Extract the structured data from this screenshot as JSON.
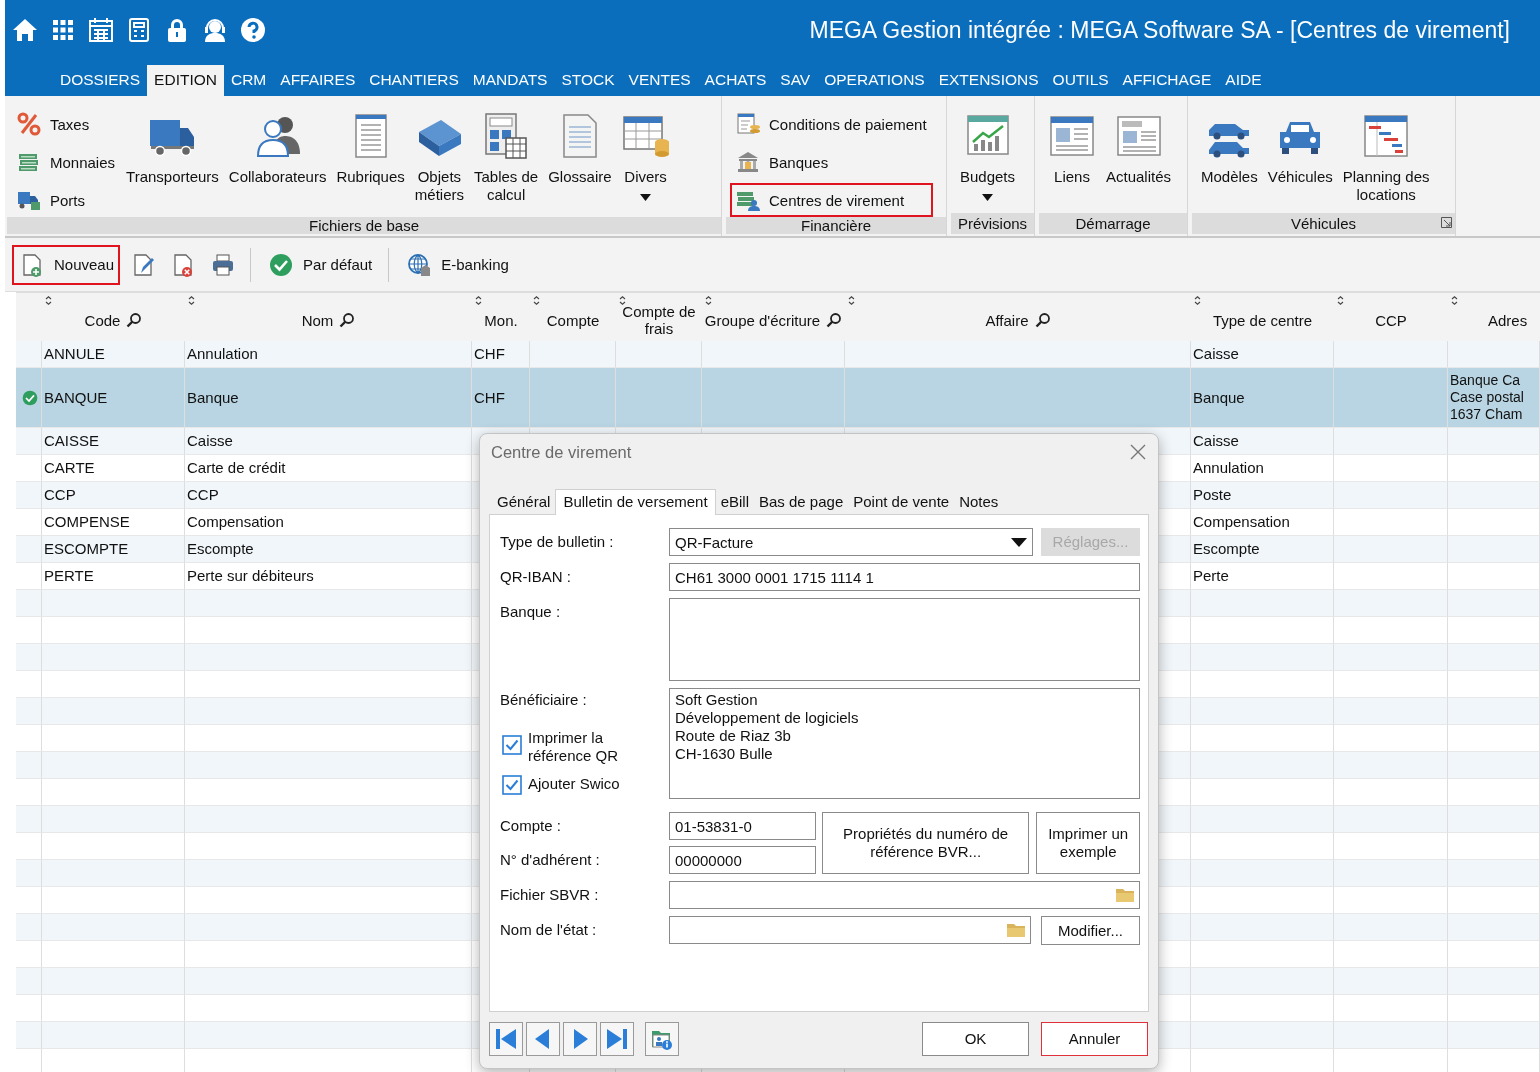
{
  "window": {
    "title": "MEGA Gestion intégrée : MEGA Software SA - [Centres de virement]"
  },
  "menu": [
    {
      "label": "DOSSIERS",
      "selected": false
    },
    {
      "label": "EDITION",
      "selected": true
    },
    {
      "label": "CRM",
      "selected": false
    },
    {
      "label": "AFFAIRES",
      "selected": false
    },
    {
      "label": "CHANTIERS",
      "selected": false
    },
    {
      "label": "MANDATS",
      "selected": false
    },
    {
      "label": "STOCK",
      "selected": false
    },
    {
      "label": "VENTES",
      "selected": false
    },
    {
      "label": "ACHATS",
      "selected": false
    },
    {
      "label": "SAV",
      "selected": false
    },
    {
      "label": "OPERATIONS",
      "selected": false
    },
    {
      "label": "EXTENSIONS",
      "selected": false
    },
    {
      "label": "OUTILS",
      "selected": false
    },
    {
      "label": "AFFICHAGE",
      "selected": false
    },
    {
      "label": "AIDE",
      "selected": false
    }
  ],
  "ribbon": {
    "groups": [
      {
        "label": "Fichiers de base",
        "items": [
          {
            "kind": "small",
            "label": "Taxes",
            "highlighted": false,
            "dropdown": false
          },
          {
            "kind": "small",
            "label": "Monnaies",
            "highlighted": false,
            "dropdown": false
          },
          {
            "kind": "small",
            "label": "Ports",
            "highlighted": false,
            "dropdown": false
          },
          {
            "kind": "large",
            "label": "Transporteurs",
            "highlighted": false,
            "dropdown": false
          },
          {
            "kind": "large",
            "label": "Collaborateurs",
            "highlighted": false,
            "dropdown": false
          },
          {
            "kind": "large",
            "label": "Rubriques",
            "highlighted": false,
            "dropdown": false
          },
          {
            "kind": "large",
            "label": "Objets\nmétiers",
            "highlighted": false,
            "dropdown": false
          },
          {
            "kind": "large",
            "label": "Tables de\ncalcul",
            "highlighted": false,
            "dropdown": false
          },
          {
            "kind": "large",
            "label": "Glossaire",
            "highlighted": false,
            "dropdown": false
          },
          {
            "kind": "large",
            "label": "Divers",
            "highlighted": false,
            "dropdown": true
          }
        ]
      },
      {
        "label": "Financière",
        "items": [
          {
            "kind": "small",
            "label": "Conditions de paiement",
            "highlighted": false,
            "dropdown": false
          },
          {
            "kind": "small",
            "label": "Banques",
            "highlighted": false,
            "dropdown": false
          },
          {
            "kind": "small",
            "label": "Centres de virement",
            "highlighted": true,
            "dropdown": false
          }
        ]
      },
      {
        "label": "Prévisions",
        "items": [
          {
            "kind": "large",
            "label": "Budgets",
            "highlighted": false,
            "dropdown": true
          }
        ]
      },
      {
        "label": "Démarrage",
        "items": [
          {
            "kind": "large",
            "label": "Liens",
            "highlighted": false,
            "dropdown": false
          },
          {
            "kind": "large",
            "label": "Actualités",
            "highlighted": false,
            "dropdown": false
          }
        ]
      },
      {
        "label": "Véhicules",
        "launcher": true,
        "items": [
          {
            "kind": "large",
            "label": "Modèles",
            "highlighted": false,
            "dropdown": false
          },
          {
            "kind": "large",
            "label": "Véhicules",
            "highlighted": false,
            "dropdown": false
          },
          {
            "kind": "large",
            "label": "Planning des\nlocations",
            "highlighted": false,
            "dropdown": false
          }
        ]
      }
    ]
  },
  "toolbar": {
    "buttons": [
      {
        "label": "Nouveau",
        "highlighted": true
      },
      {
        "label": "Par défaut",
        "highlighted": false
      },
      {
        "label": "E-banking",
        "highlighted": false
      }
    ]
  },
  "grid": {
    "columns": [
      {
        "label": "Code",
        "filter": true
      },
      {
        "label": "Nom",
        "filter": true
      },
      {
        "label": "Mon."
      },
      {
        "label": "Compte"
      },
      {
        "label": "Compte de frais"
      },
      {
        "label": "Groupe d'écriture",
        "filter": true
      },
      {
        "label": "Affaire",
        "filter": true
      },
      {
        "label": "Type de centre"
      },
      {
        "label": "CCP"
      },
      {
        "label": "Adres"
      }
    ],
    "rows": [
      {
        "selected": false,
        "default": false,
        "code": "ANNULE",
        "nom": "Annulation",
        "mon": "CHF",
        "type_de_centre": "Caisse"
      },
      {
        "selected": true,
        "default": true,
        "code": "BANQUE",
        "nom": "Banque",
        "mon": "CHF",
        "type_de_centre": "Banque",
        "adresse": "Banque Ca\nCase postal\n1637 Cham"
      },
      {
        "selected": false,
        "default": false,
        "code": "CAISSE",
        "nom": "Caisse",
        "type_de_centre": "Caisse"
      },
      {
        "selected": false,
        "default": false,
        "code": "CARTE",
        "nom": "Carte de crédit",
        "type_de_centre": "Annulation"
      },
      {
        "selected": false,
        "default": false,
        "code": "CCP",
        "nom": "CCP",
        "type_de_centre": "Poste"
      },
      {
        "selected": false,
        "default": false,
        "code": "COMPENSE",
        "nom": "Compensation",
        "type_de_centre": "Compensation"
      },
      {
        "selected": false,
        "default": false,
        "code": "ESCOMPTE",
        "nom": "Escompte",
        "type_de_centre": "Escompte"
      },
      {
        "selected": false,
        "default": false,
        "code": "PERTE",
        "nom": "Perte sur débiteurs",
        "type_de_centre": "Perte"
      }
    ]
  },
  "dialog": {
    "title": "Centre de virement",
    "tabs": [
      {
        "label": "Général",
        "selected": false
      },
      {
        "label": "Bulletin de versement",
        "selected": true
      },
      {
        "label": "eBill",
        "selected": false
      },
      {
        "label": "Bas de page",
        "selected": false
      },
      {
        "label": "Point de vente",
        "selected": false
      },
      {
        "label": "Notes",
        "selected": false
      }
    ],
    "type_bulletin": {
      "label": "Type de bulletin :",
      "value": "QR-Facture"
    },
    "reglages": {
      "label": "Réglages...",
      "disabled": true
    },
    "qr_iban": {
      "label": "QR-IBAN :",
      "value": "CH61 3000 0001 1715 1114 1"
    },
    "banque": {
      "label": "Banque :"
    },
    "beneficiaire": {
      "label": "Bénéficiaire :",
      "value": "Soft Gestion\nDéveloppement de logiciels\nRoute de Riaz 3b\nCH-1630 Bulle"
    },
    "checkboxes": [
      {
        "label": "Imprimer la\nréférence QR",
        "checked": true
      },
      {
        "label": "Ajouter Swico",
        "checked": true
      }
    ],
    "compte": {
      "label": "Compte :",
      "value": "01-53831-0"
    },
    "adherent": {
      "label": "N° d'adhérent :",
      "value": "00000000"
    },
    "proprietes": {
      "label": "Propriétés du numéro de\nréférence BVR..."
    },
    "imprimer": {
      "label": "Imprimer un\nexemple"
    },
    "fichier_sbvr": {
      "label": "Fichier SBVR :"
    },
    "nom_etat": {
      "label": "Nom de l'état :"
    },
    "modifier": {
      "label": "Modifier..."
    },
    "ok": {
      "label": "OK",
      "focused": false
    },
    "annuler": {
      "label": "Annuler",
      "focused": true
    }
  }
}
